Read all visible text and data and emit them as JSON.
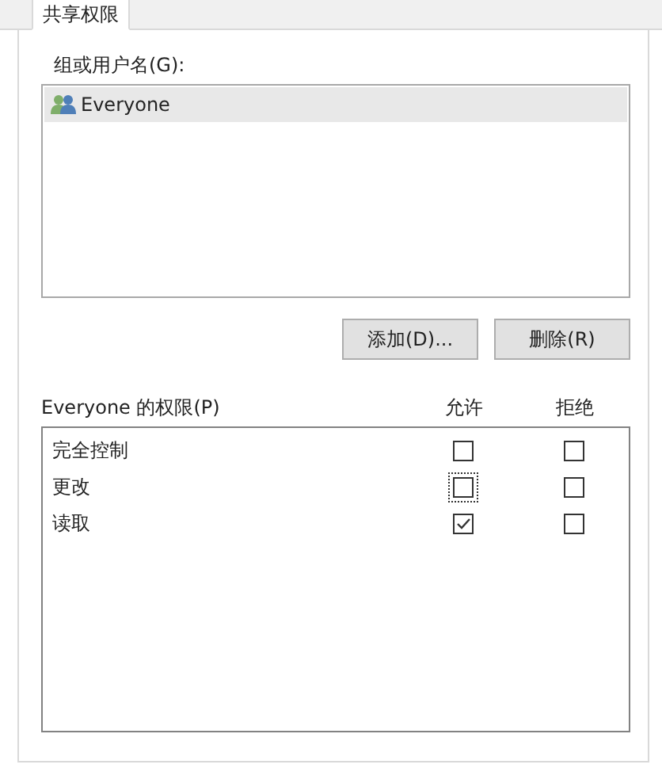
{
  "tabs": [
    {
      "label": "共享权限",
      "selected": true
    }
  ],
  "users": {
    "label": "组或用户名(G):",
    "items": [
      {
        "name": "Everyone",
        "selected": true
      }
    ]
  },
  "buttons": [
    {
      "label": "添加(D)..."
    },
    {
      "label": "删除(R)"
    }
  ],
  "permissions": {
    "label": "Everyone 的权限(P)",
    "columns": [
      "允许",
      "拒绝"
    ],
    "rows": [
      {
        "name": "完全控制",
        "allow": false,
        "deny": false,
        "focused": false
      },
      {
        "name": "更改",
        "allow": false,
        "deny": false,
        "focused": true
      },
      {
        "name": "读取",
        "allow": true,
        "deny": false,
        "focused": false
      }
    ]
  }
}
